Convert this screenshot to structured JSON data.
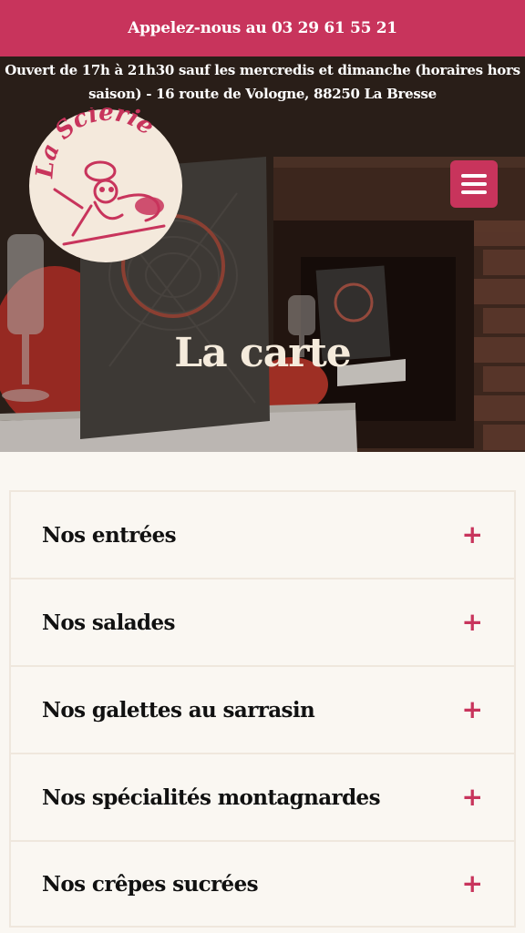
{
  "topbar": {
    "phone_text": "Appelez-nous au 03 29 61 55 21"
  },
  "hero": {
    "hours_line1": "Ouvert de 17h à 21h30 sauf les mercredis et dimanche (horaires hors",
    "hours_line2": "saison) - 16 route de Vologne, 88250 La Bresse",
    "logo_text": "La Scierie",
    "title": "La carte"
  },
  "menu": {
    "items": [
      {
        "label": "Nos entrées"
      },
      {
        "label": "Nos salades"
      },
      {
        "label": "Nos galettes au sarrasin"
      },
      {
        "label": "Nos spécialités montagnardes"
      },
      {
        "label": "Nos crêpes sucrées"
      }
    ],
    "expand_symbol": "+"
  },
  "colors": {
    "accent": "#c8345c",
    "background": "#faf7f2",
    "title_text": "#f5ebdc"
  },
  "icons": {
    "menu": "hamburger-icon",
    "expand": "plus-icon"
  }
}
